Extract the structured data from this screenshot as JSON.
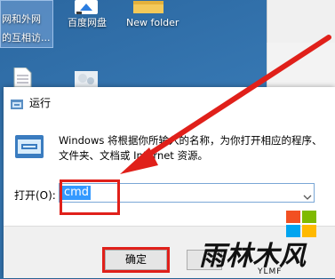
{
  "desktop": {
    "icons": [
      {
        "label_line1": "网和外网",
        "label_line2": "的互相访...",
        "name": "network-shortcut"
      },
      {
        "label_line1": "百度网盘",
        "name": "baidu-netdisk"
      },
      {
        "label_line1": "New folder",
        "name": "new-folder"
      }
    ]
  },
  "dialog": {
    "title": "运行",
    "description": "Windows 将根据你所输入的名称，为你打开相应的程序、文件夹、文档或 Internet 资源。",
    "open_label": "打开(O):",
    "input_value": "cmd",
    "ok_label": "确定"
  },
  "annotation": {
    "arrow_color": "#e0201a"
  },
  "watermark": {
    "text": "雨林木风",
    "sub": "YLMF"
  }
}
